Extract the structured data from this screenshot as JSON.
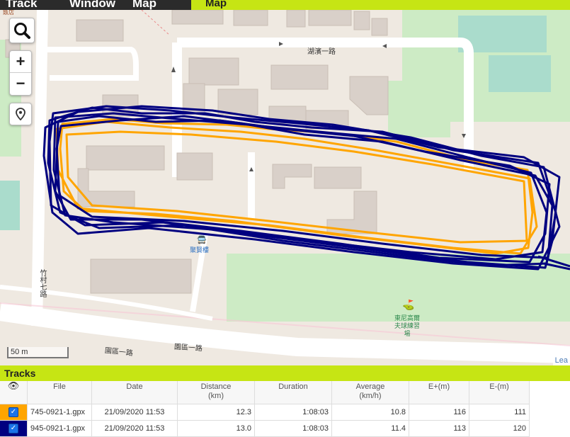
{
  "menu": {
    "items": [
      "Track",
      "Window",
      "Map"
    ],
    "active_tab": "Map"
  },
  "map": {
    "scale_label": "50 m",
    "attribution": "Lea",
    "street_labels": [
      "湖濱一路",
      "竹村七路",
      "園區一路",
      "園區一路"
    ],
    "station_label": "聚賢樓",
    "poi_label": [
      "東尼高爾",
      "夫球練習",
      "場"
    ],
    "corner_label": "飯店",
    "controls": {
      "search_icon": "magnifier",
      "zoom_in": "+",
      "zoom_out": "−",
      "locate_icon": "location-pin"
    },
    "track_colors": {
      "track1": "#ffa500",
      "track2": "#000080"
    }
  },
  "tracks_panel": {
    "title": "Tracks",
    "columns": [
      "File",
      "Date",
      "Distance\n(km)",
      "Duration",
      "Average\n(km/h)",
      "E+(m)",
      "E-(m)"
    ],
    "rows": [
      {
        "color": "#ffa500",
        "checked": true,
        "file": "745-0921-1.gpx",
        "date": "21/09/2020 11:53",
        "distance": "12.3",
        "duration": "1:08:03",
        "average": "10.8",
        "eplus": "116",
        "eminus": "111"
      },
      {
        "color": "#000080",
        "checked": true,
        "file": "945-0921-1.gpx",
        "date": "21/09/2020 11:53",
        "distance": "13.0",
        "duration": "1:08:03",
        "average": "11.4",
        "eplus": "113",
        "eminus": "120"
      }
    ]
  }
}
